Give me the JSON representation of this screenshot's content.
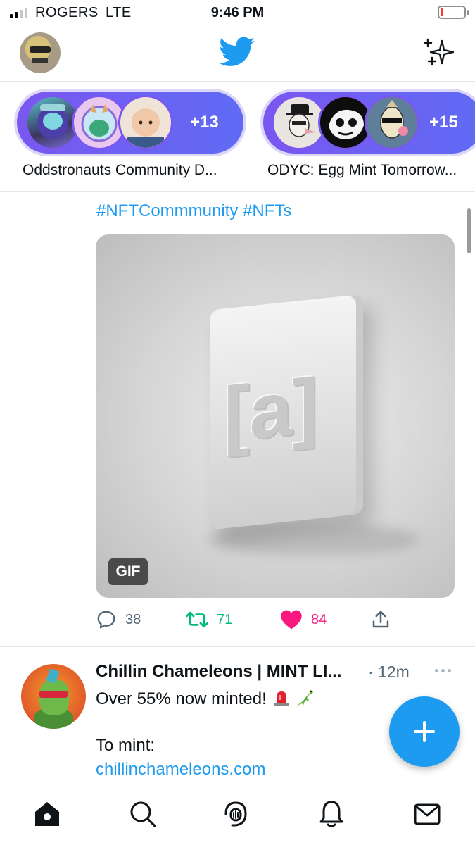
{
  "status_bar": {
    "carrier": "ROGERS",
    "network": "LTE",
    "time": "9:46 PM",
    "signal_bars_active": 2,
    "signal_bars_total": 4,
    "battery_level": 0.1,
    "battery_color": "#ff3b30"
  },
  "header": {
    "profile_avatar_icon": "profile-avatar",
    "logo_icon": "twitter-bird-icon",
    "sparkle_icon": "sparkle-icon",
    "brand_color": "#1d9bf0"
  },
  "spaces": [
    {
      "title": "Oddstronauts Community D...",
      "extra_count": "+13"
    },
    {
      "title": "ODYC: Egg Mint Tomorrow...",
      "extra_count": "+15"
    }
  ],
  "tweet1": {
    "hashtags": "#NFTCommmunity #NFTs",
    "media_badge": "GIF",
    "reply_count": "38",
    "retweet_count": "71",
    "like_count": "84",
    "retweet_color": "#00ba7c",
    "like_color": "#f91880"
  },
  "tweet2": {
    "author": "Chillin Chameleons | MINT LI...",
    "time": "· 12m",
    "text_line1": "Over 55% now minted!",
    "text_line2": "To mint:",
    "link": "chillinchameleons.com"
  },
  "bottom_nav": [
    "home-icon",
    "search-icon",
    "spaces-icon",
    "notifications-icon",
    "messages-icon"
  ]
}
